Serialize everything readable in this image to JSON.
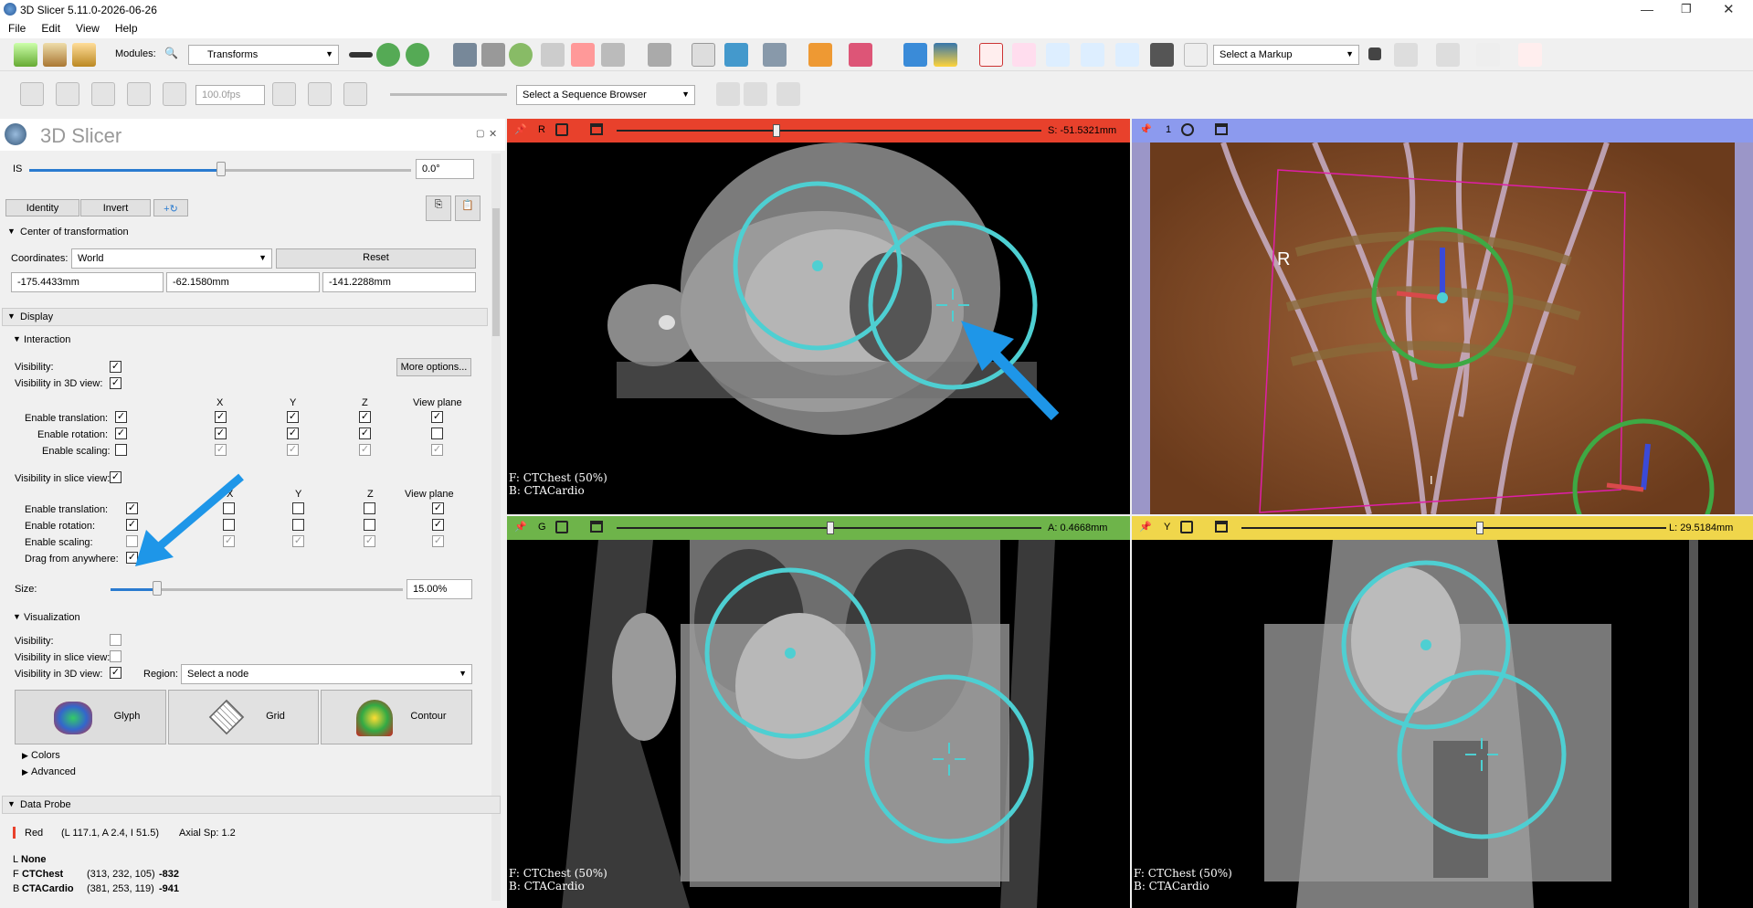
{
  "window": {
    "title": "3D Slicer 5.11.0-2026-06-26"
  },
  "menu": [
    "File",
    "Edit",
    "View",
    "Help"
  ],
  "toolbar": {
    "modules_label": "Modules:",
    "module_selected": "Transforms",
    "markup_select": "Select a Markup",
    "fps": "100.0fps",
    "sequence_browser": "Select a Sequence Browser"
  },
  "panel": {
    "header": "3D Slicer",
    "is_label": "IS",
    "is_value": "0.0°",
    "identity": "Identity",
    "invert": "Invert",
    "center_section": "Center of transformation",
    "coordinates_label": "Coordinates:",
    "coordinates_value": "World",
    "reset": "Reset",
    "coord_x": "-175.4433mm",
    "coord_y": "-62.1580mm",
    "coord_z": "-141.2288mm",
    "display_section": "Display",
    "interaction_section": "Interaction",
    "visibility": "Visibility:",
    "more_options": "More options...",
    "vis3d": "Visibility in 3D view:",
    "col_x": "X",
    "col_y": "Y",
    "col_z": "Z",
    "col_vp": "View plane",
    "enable_translation": "Enable translation:",
    "enable_rotation": "Enable rotation:",
    "enable_scaling": "Enable scaling:",
    "vis_slice": "Visibility in slice view:",
    "drag_anywhere": "Drag from anywhere:",
    "size_label": "Size:",
    "size_value": "15.00%",
    "visualization_section": "Visualization",
    "viz_visibility": "Visibility:",
    "viz_vis_slice": "Visibility in slice view:",
    "viz_vis3d": "Visibility in 3D view:",
    "region_label": "Region:",
    "region_value": "Select a node",
    "glyph": "Glyph",
    "grid": "Grid",
    "contour": "Contour",
    "colors": "Colors",
    "advanced": "Advanced",
    "data_probe": "Data Probe",
    "probe_view": "Red",
    "probe_coords": "(L 117.1, A 2.4, I 51.5)",
    "probe_axial": "Axial Sp: 1.2",
    "probe_l_prefix": "L",
    "probe_l": "None",
    "probe_f_prefix": "F",
    "probe_f_name": "CTChest",
    "probe_f_ijk": "(313, 232, 105)",
    "probe_f_val": "-832",
    "probe_b_prefix": "B",
    "probe_b_name": "CTACardio",
    "probe_b_ijk": "(381, 253, 119)",
    "probe_b_val": "-941"
  },
  "views": {
    "red": {
      "letter": "R",
      "offset": "S: -51.5321mm",
      "color": "#e8412c",
      "fg": "F: CTChest (50%)",
      "bg": "B: CTACardio"
    },
    "threeD": {
      "letter": "1",
      "color": "#8c9aee",
      "orient": "R",
      "orient_bottom": "I"
    },
    "green": {
      "letter": "G",
      "offset": "A: 0.4668mm",
      "color": "#6eb44a",
      "fg": "F: CTChest (50%)",
      "bg": "B: CTACardio"
    },
    "yellow": {
      "letter": "Y",
      "offset": "L: 29.5184mm",
      "color": "#f0d64b",
      "fg": "F: CTChest (50%)",
      "bg": "B: CTACardio"
    }
  },
  "colors": {
    "accent_arrow": "#1e96e8",
    "widget_ring": "#4ecfd2",
    "widget_green": "#3ea944"
  }
}
